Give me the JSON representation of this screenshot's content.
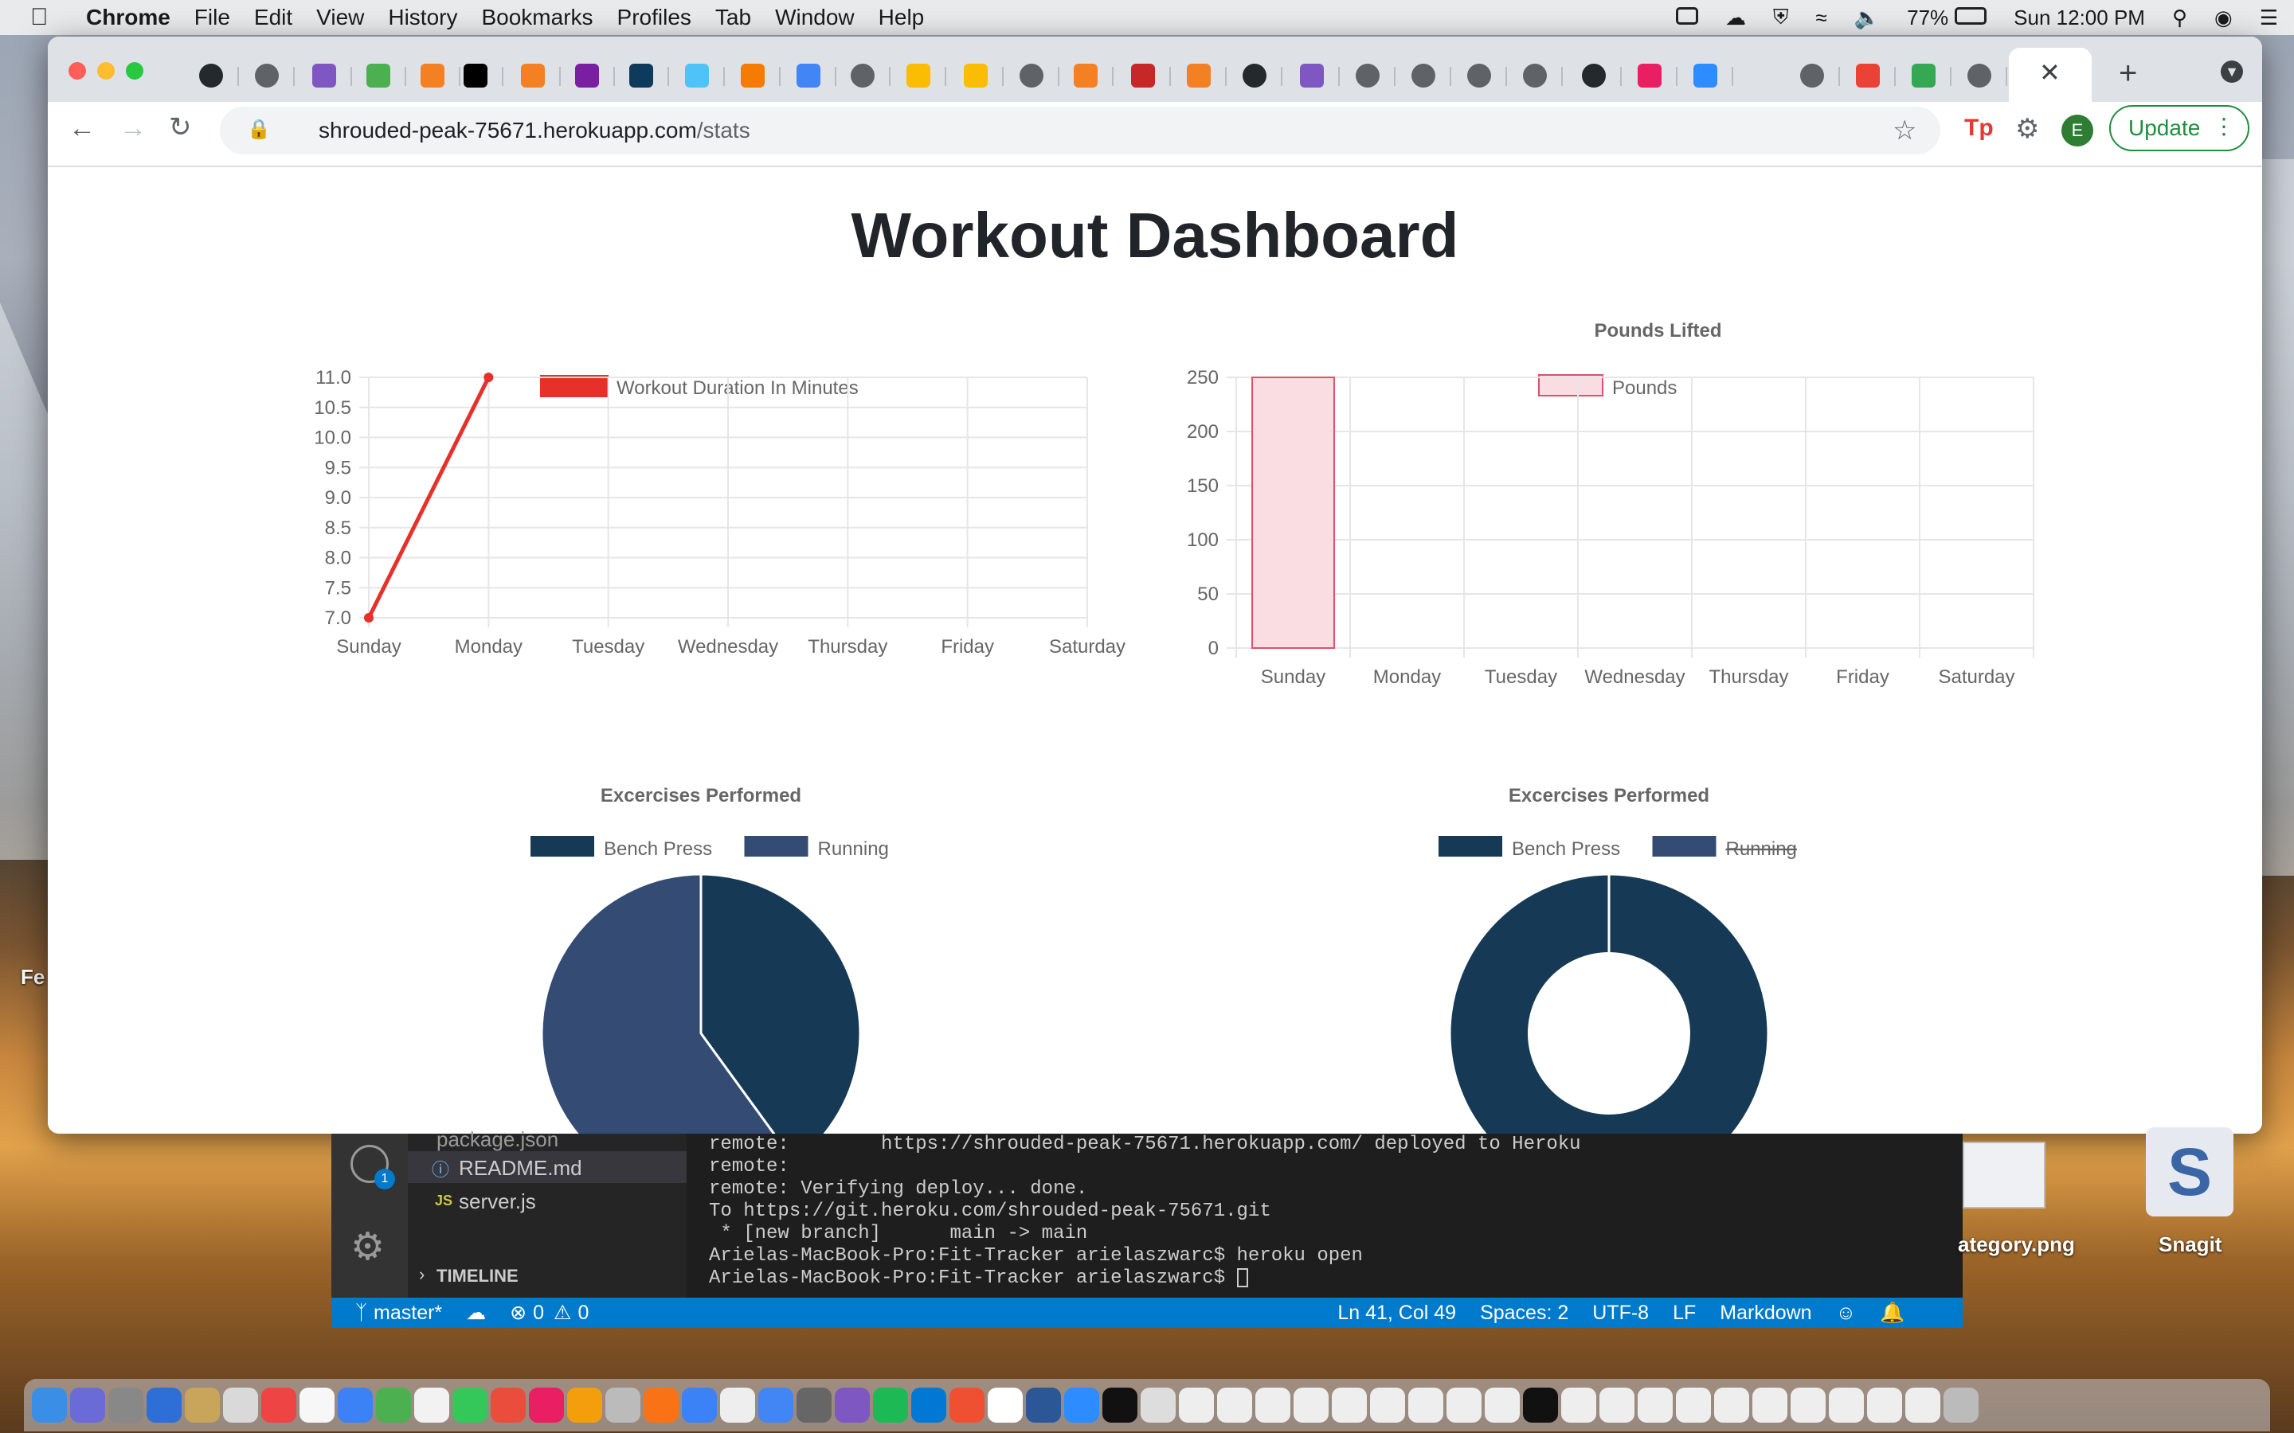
{
  "menubar": {
    "app": "Chrome",
    "items": [
      "File",
      "Edit",
      "View",
      "History",
      "Bookmarks",
      "Profiles",
      "Tab",
      "Window",
      "Help"
    ],
    "battery": "77%",
    "clock": "Sun 12:00 PM"
  },
  "browser": {
    "url_host": "shrouded-peak-75671.herokuapp.com",
    "url_path": "/stats",
    "update_label": "Update",
    "profile_initial": "E",
    "tp_label": "Tp"
  },
  "page": {
    "title": "Workout Dashboard"
  },
  "chart_data": [
    {
      "type": "line",
      "legend": [
        "Workout Duration In Minutes"
      ],
      "categories": [
        "Sunday",
        "Monday",
        "Tuesday",
        "Wednesday",
        "Thursday",
        "Friday",
        "Saturday"
      ],
      "series": [
        {
          "name": "Workout Duration In Minutes",
          "values": [
            7,
            11,
            null,
            null,
            null,
            null,
            null
          ],
          "color": "#e8302a"
        }
      ],
      "yticks": [
        "11.0",
        "10.5",
        "10.0",
        "9.5",
        "9.0",
        "8.5",
        "8.0",
        "7.5",
        "7.0"
      ],
      "ylim": [
        7,
        11
      ],
      "grid": true,
      "legend_position": "top"
    },
    {
      "type": "bar",
      "title": "Pounds Lifted",
      "legend": [
        "Pounds"
      ],
      "categories": [
        "Sunday",
        "Monday",
        "Tuesday",
        "Wednesday",
        "Thursday",
        "Friday",
        "Saturday"
      ],
      "series": [
        {
          "name": "Pounds",
          "values": [
            250,
            null,
            null,
            null,
            null,
            null,
            null
          ],
          "color": "#f9dde2",
          "border": "#e0506a"
        }
      ],
      "yticks": [
        "250",
        "200",
        "150",
        "100",
        "50",
        "0"
      ],
      "ylim": [
        0,
        250
      ],
      "grid": true,
      "legend_position": "top"
    },
    {
      "type": "pie",
      "title": "Excercises Performed",
      "legend": [
        "Bench Press",
        "Running"
      ],
      "values": [
        40,
        60
      ],
      "colors": [
        "#163a55",
        "#344b74"
      ],
      "legend_position": "top"
    },
    {
      "type": "pie",
      "title": "Excercises Performed",
      "legend": [
        "Bench Press",
        "Running"
      ],
      "hidden": [
        "Running"
      ],
      "values": [
        100
      ],
      "colors": [
        "#163a55"
      ],
      "legend_position": "top"
    }
  ],
  "vscode": {
    "files": [
      "package.json",
      "README.md",
      "server.js"
    ],
    "timeline": "TIMELINE",
    "terminal_lines": [
      "remote:        https://shrouded-peak-75671.herokuapp.com/ deployed to Heroku",
      "remote:",
      "remote: Verifying deploy... done.",
      "To https://git.heroku.com/shrouded-peak-75671.git",
      " * [new branch]      main -> main",
      "Arielas-MacBook-Pro:Fit-Tracker arielaszwarc$ heroku open",
      "Arielas-MacBook-Pro:Fit-Tracker arielaszwarc$ "
    ],
    "status": {
      "branch": "master*",
      "problems": "0",
      "warnings": "0",
      "position": "Ln 41, Col 49",
      "spaces": "Spaces: 2",
      "encoding": "UTF-8",
      "eol": "LF",
      "language": "Markdown"
    }
  },
  "desktop": {
    "items": [
      "ategory.png",
      "Snagit"
    ],
    "edge_text": "Fe"
  },
  "colors": {
    "accent_line": "#e8302a",
    "pie_dark": "#163a55",
    "pie_mid": "#344b74",
    "update_green": "#1e8e3e",
    "vscode_blue": "#007acc"
  }
}
